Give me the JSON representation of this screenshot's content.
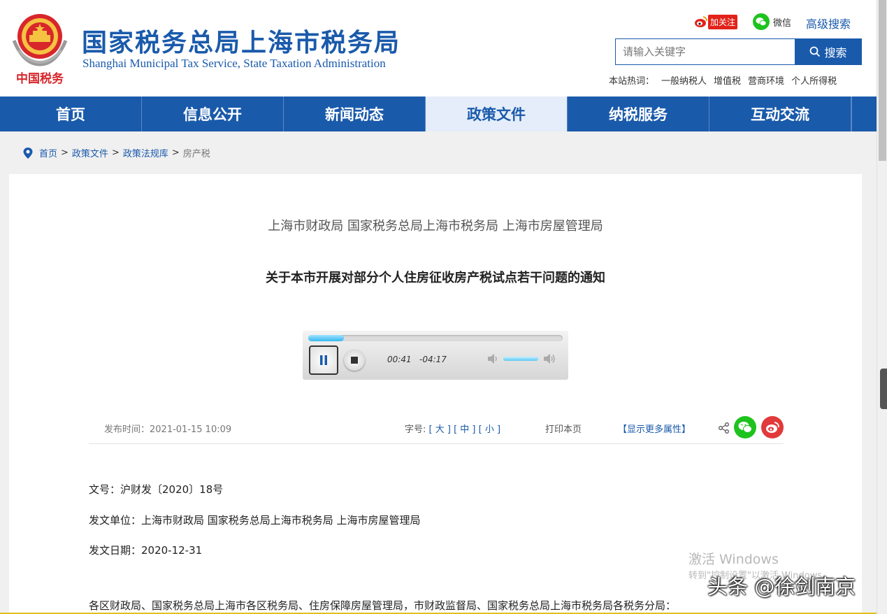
{
  "header": {
    "emblem_text": "中国税务",
    "title_cn": "国家税务总局上海市税务局",
    "title_en": "Shanghai Municipal Tax Service, State Taxation Administration",
    "weibo_follow_label": "加关注",
    "wechat_label": "微信",
    "advanced_search_label": "高级搜索",
    "search_placeholder": "请输入关键字",
    "search_button_label": "搜索",
    "hot_words_label": "本站热词：",
    "hot_words": [
      "一般纳税人",
      "增值税",
      "营商环境",
      "个人所得税"
    ]
  },
  "nav": {
    "items": [
      "首页",
      "信息公开",
      "新闻动态",
      "政策文件",
      "纳税服务",
      "互动交流"
    ],
    "active": "政策文件"
  },
  "breadcrumb": {
    "items": [
      "首页",
      "政策文件",
      "政策法规库"
    ],
    "current": "房产税",
    "separator": ">"
  },
  "document": {
    "issuers": "上海市财政局 国家税务总局上海市税务局 上海市房屋管理局",
    "title": "关于本市开展对部分个人住房征收房产税试点若干问题的通知",
    "publish_time": "发布时间：2021-01-15 10:09",
    "font_size_label": "字号:",
    "font_sizes": [
      "[ 大 ]",
      "[ 中 ]",
      "[ 小 ]"
    ],
    "print_label": "打印本页",
    "more_attrs_label": "【显示更多属性】",
    "doc_number": "文号：沪财发〔2020〕18号",
    "issuing_unit": "发文单位：上海市财政局 国家税务总局上海市税务局 上海市房屋管理局",
    "issue_date": "发文日期：2020-12-31",
    "recipients": "各区财政局、国家税务总局上海市各区税务局、住房保障房屋管理局，市财政监督局、国家税务总局上海市税务局各税务分局："
  },
  "player": {
    "elapsed": "00:41",
    "remaining": "-04:17",
    "progress": 0.14,
    "volume": 1.0,
    "state": "playing"
  },
  "watermark": {
    "activate_title": "激活 Windows",
    "activate_sub": "转到\"控制设置\"以激活 Windows。",
    "toutiao": "头条 @徐剑南京"
  },
  "colors": {
    "brand_blue": "#1a5aab",
    "nav_active_bg": "#e4edf9",
    "weibo_red": "#e2231a",
    "wechat_green": "#1ec31e"
  }
}
